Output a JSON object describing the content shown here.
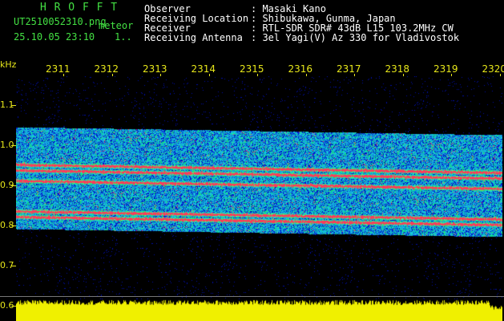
{
  "header": {
    "title": "H R O F F T",
    "filename": "UT2510052310.png",
    "meteor_label": "meteor",
    "datetime": "25.10.05 23:10",
    "extra": "1.."
  },
  "info": {
    "observer_label": "Observer",
    "observer_value": ": Masaki Kano",
    "location_label": "Receiving Location",
    "location_value": ": Shibukawa, Gunma, Japan",
    "receiver_label": "Receiver",
    "receiver_value": ": RTL-SDR SDR# 43dB L15 103.2MHz CW",
    "antenna_label": "Receiving Antenna",
    "antenna_value": ": 3el Yagi(V) Az 330 for Vladivostok"
  },
  "axis": {
    "unit_label": "kHz",
    "y_ticks": [
      "1.1",
      "1.0",
      "0.9",
      "0.8",
      "0.7",
      "0.6"
    ],
    "x_ticks": [
      "2311",
      "2312",
      "2313",
      "2314",
      "2315",
      "2316",
      "2317",
      "2318",
      "2319",
      "2320"
    ]
  },
  "colors": {
    "background": "#000000",
    "axis_text": "#e6e61a",
    "header_text": "#ffffff",
    "title_green": "#43e043",
    "level_fill": "#f0f000"
  }
}
